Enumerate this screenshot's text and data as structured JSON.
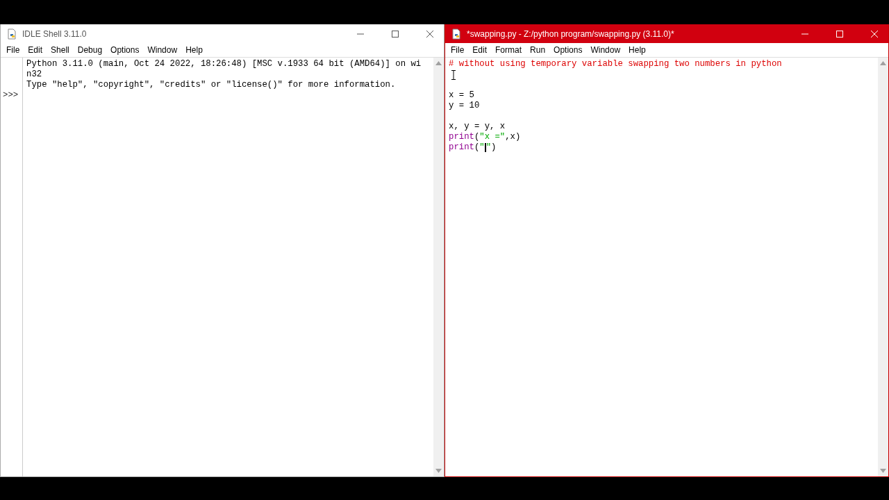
{
  "windows": [
    {
      "title": "IDLE Shell 3.11.0",
      "active": false,
      "menu": [
        "File",
        "Edit",
        "Shell",
        "Debug",
        "Options",
        "Window",
        "Help"
      ],
      "gutter": true,
      "lines": [
        {
          "kind": "code",
          "tokens": [
            {
              "kind": "plain",
              "text": "Python 3.11.0 (main, Oct 24 2022, 18:26:48) [MSC v.1933 64 bit (AMD64)] on wi"
            }
          ]
        },
        {
          "kind": "code",
          "tokens": [
            {
              "kind": "plain",
              "text": "n32"
            }
          ]
        },
        {
          "kind": "code",
          "tokens": [
            {
              "kind": "plain",
              "text": "Type \"help\", \"copyright\", \"credits\" or \"license()\" for more information."
            }
          ]
        },
        {
          "kind": "blank",
          "prompt": ">>>"
        }
      ]
    },
    {
      "title": "*swapping.py - Z:/python program/swapping.py (3.11.0)*",
      "active": true,
      "menu": [
        "File",
        "Edit",
        "Format",
        "Run",
        "Options",
        "Window",
        "Help"
      ],
      "lines": [
        {
          "kind": "code",
          "tokens": [
            {
              "kind": "comment",
              "text": "# without using temporary variable swapping two numbers in python"
            }
          ]
        },
        {
          "kind": "blank"
        },
        {
          "kind": "blank"
        },
        {
          "kind": "code",
          "tokens": [
            {
              "kind": "plain",
              "text": "x = 5"
            }
          ]
        },
        {
          "kind": "code",
          "tokens": [
            {
              "kind": "plain",
              "text": "y = 10"
            }
          ]
        },
        {
          "kind": "blank"
        },
        {
          "kind": "code",
          "tokens": [
            {
              "kind": "plain",
              "text": "x, y = y, x"
            }
          ]
        },
        {
          "kind": "code",
          "tokens": [
            {
              "kind": "builtin",
              "text": "print"
            },
            {
              "kind": "plain",
              "text": "("
            },
            {
              "kind": "string",
              "text": "\"x =\""
            },
            {
              "kind": "plain",
              "text": ",x)"
            }
          ]
        },
        {
          "kind": "code",
          "tokens": [
            {
              "kind": "builtin",
              "text": "print"
            },
            {
              "kind": "plain",
              "text": "("
            },
            {
              "kind": "string",
              "text": "\""
            },
            {
              "kind": "caret"
            },
            {
              "kind": "string",
              "text": "\""
            },
            {
              "kind": "plain",
              "text": ")"
            }
          ]
        }
      ]
    }
  ]
}
